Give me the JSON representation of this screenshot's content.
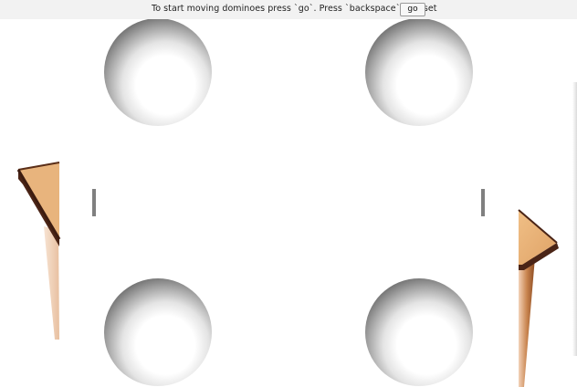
{
  "toolbar": {
    "instruction_text": "To start moving dominoes press `go`. Press `backspace` to reset",
    "go_label": "go"
  },
  "scene": {
    "background_color": "#ffffff",
    "bar_background_color": "#f2f2f2",
    "table_top_color": "#e8b47d",
    "table_edge_color": "#4a2416",
    "table_leg_color": "#d28f60",
    "sphere_light_color": "#ffffff",
    "sphere_dark_color": "#6d6d6d",
    "domino_color": "#808080",
    "spheres": [
      "shaded-sphere-top-left",
      "shaded-sphere-top-right",
      "shaded-sphere-bottom-left",
      "shaded-sphere-bottom-right"
    ],
    "dominoes": [
      "domino-left",
      "domino-right"
    ]
  }
}
